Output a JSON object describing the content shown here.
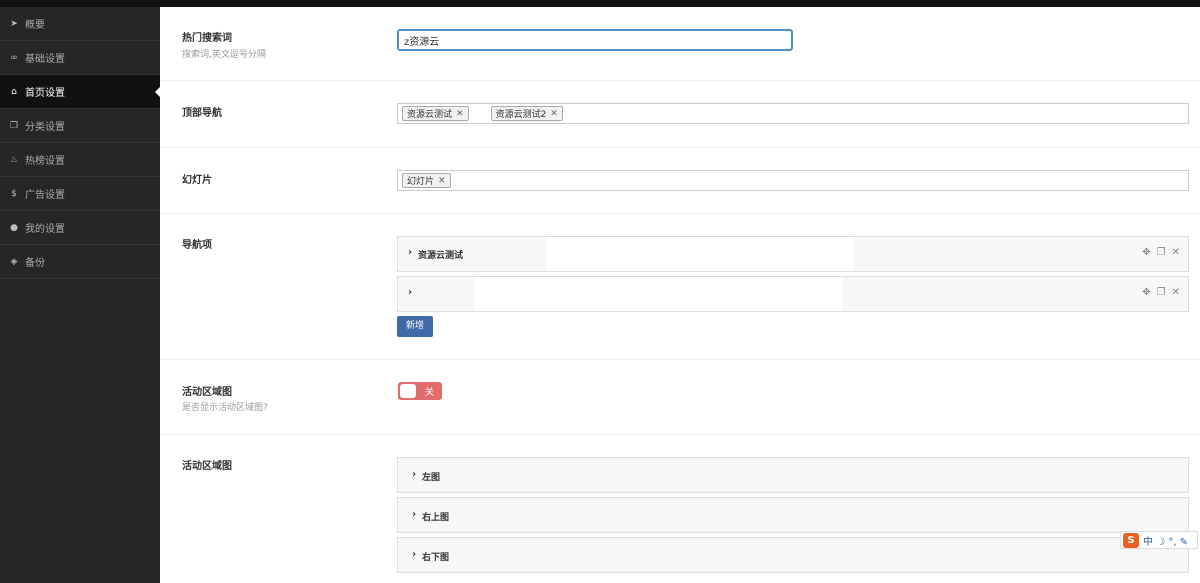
{
  "sidebar": {
    "items": [
      {
        "label": "概要",
        "icon": "rocket-icon",
        "glyph": "➤"
      },
      {
        "label": "基础设置",
        "icon": "link-icon",
        "glyph": "∞"
      },
      {
        "label": "首页设置",
        "icon": "home-icon",
        "glyph": "⌂"
      },
      {
        "label": "分类设置",
        "icon": "copy-icon",
        "glyph": "❐"
      },
      {
        "label": "热榜设置",
        "icon": "fire-icon",
        "glyph": "♨"
      },
      {
        "label": "广告设置",
        "icon": "dollar-icon",
        "glyph": "$"
      },
      {
        "label": "我的设置",
        "icon": "user-icon",
        "glyph": "●"
      },
      {
        "label": "备份",
        "icon": "shield-icon",
        "glyph": "◈"
      }
    ],
    "active_index": 2
  },
  "hot_search": {
    "label": "热门搜索词",
    "desc": "搜索词,英文逗号分隔",
    "value": "z资源云"
  },
  "top_nav": {
    "label": "顶部导航",
    "tags": [
      "资源云测试",
      "资源云测试2"
    ]
  },
  "slides": {
    "label": "幻灯片",
    "tags": [
      "幻灯片"
    ]
  },
  "nav_items": {
    "label": "导航项",
    "items": [
      "资源云测试",
      ""
    ],
    "add_label": "新增"
  },
  "activity_switch": {
    "label": "活动区域图",
    "desc": "是否显示活动区域图?",
    "state_label": "关"
  },
  "activity_images": {
    "label": "活动区域图",
    "panels": [
      "左图",
      "右上图",
      "右下图"
    ]
  },
  "ime": {
    "logo": "S",
    "text": "中 ☽ °, ✎"
  },
  "colors": {
    "sidebar_bg": "#262626",
    "active_bg": "#111111",
    "primary_button": "#3f6aa7",
    "toggle_off": "#e06c6c",
    "focus_border": "#4d90c8"
  }
}
